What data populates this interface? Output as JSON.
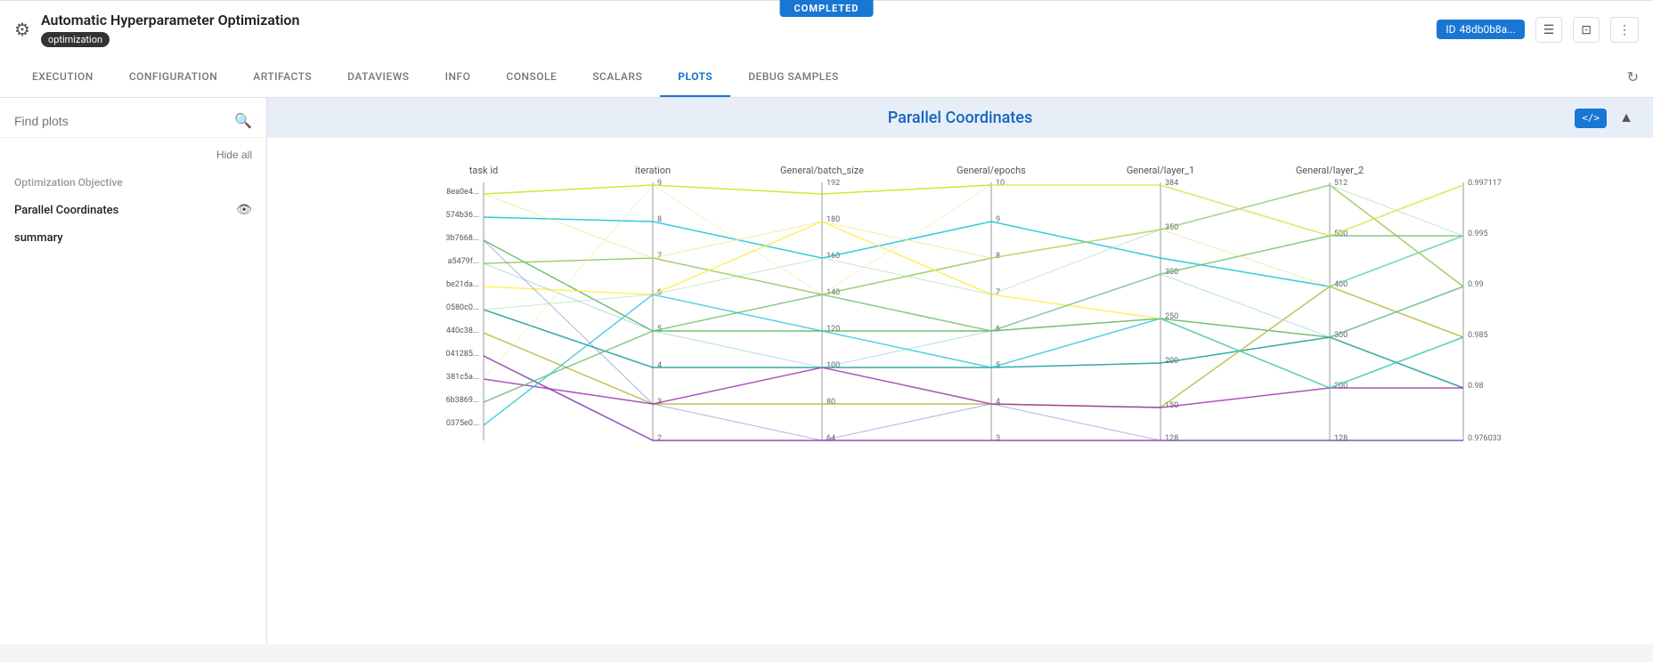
{
  "status": {
    "label": "COMPLETED",
    "color": "#1976d2"
  },
  "header": {
    "icon": "⚙",
    "title": "Automatic Hyperparameter Optimization",
    "badge": "optimization",
    "id_label": "ID",
    "id_value": "48db0b8a..."
  },
  "nav": {
    "tabs": [
      {
        "label": "EXECUTION",
        "active": false
      },
      {
        "label": "CONFIGURATION",
        "active": false
      },
      {
        "label": "ARTIFACTS",
        "active": false
      },
      {
        "label": "DATAVIEWS",
        "active": false
      },
      {
        "label": "INFO",
        "active": false
      },
      {
        "label": "CONSOLE",
        "active": false
      },
      {
        "label": "SCALARS",
        "active": false
      },
      {
        "label": "PLOTS",
        "active": true
      },
      {
        "label": "DEBUG SAMPLES",
        "active": false
      }
    ]
  },
  "sidebar": {
    "search_placeholder": "Find plots",
    "hide_all": "Hide all",
    "sections": [
      {
        "title": "Optimization Objective",
        "items": []
      },
      {
        "title": "",
        "items": [
          {
            "label": "Parallel Coordinates",
            "has_eye": true
          },
          {
            "label": "summary",
            "has_eye": false
          }
        ]
      }
    ]
  },
  "chart": {
    "title": "Parallel Coordinates",
    "axes": [
      "task id",
      "iteration",
      "General/batch_size",
      "General/epochs",
      "General/layer_1",
      "General/layer_2"
    ],
    "task_ids": [
      "8ea0e4...",
      "574b36...",
      "3b7668...",
      "a5479f...",
      "be21da...",
      "0580c0...",
      "440c38...",
      "041285...",
      "381c5a...",
      "6b3869...",
      "0375e0..."
    ],
    "axis_values": {
      "iteration": {
        "min": 2,
        "max": 9,
        "ticks": [
          2,
          3,
          4,
          5,
          6,
          7,
          8,
          9
        ]
      },
      "batch_size": {
        "min": 64,
        "max": 192,
        "ticks": [
          64,
          80,
          100,
          120,
          140,
          160,
          180,
          192
        ]
      },
      "epochs": {
        "min": 3,
        "max": 10,
        "ticks": [
          3,
          4,
          5,
          6,
          7,
          8,
          9,
          10
        ]
      },
      "layer_1": {
        "min": 128,
        "max": 384,
        "ticks": [
          128,
          150,
          200,
          250,
          300,
          350,
          384
        ]
      },
      "layer_2": {
        "min": 128,
        "max": 512,
        "ticks": [
          128,
          200,
          300,
          400,
          500,
          512
        ]
      },
      "result": {
        "min": 0.976033,
        "max": 0.997117,
        "ticks": [
          0.976033,
          0.98,
          0.985,
          0.99,
          0.995,
          0.997117
        ]
      }
    }
  }
}
